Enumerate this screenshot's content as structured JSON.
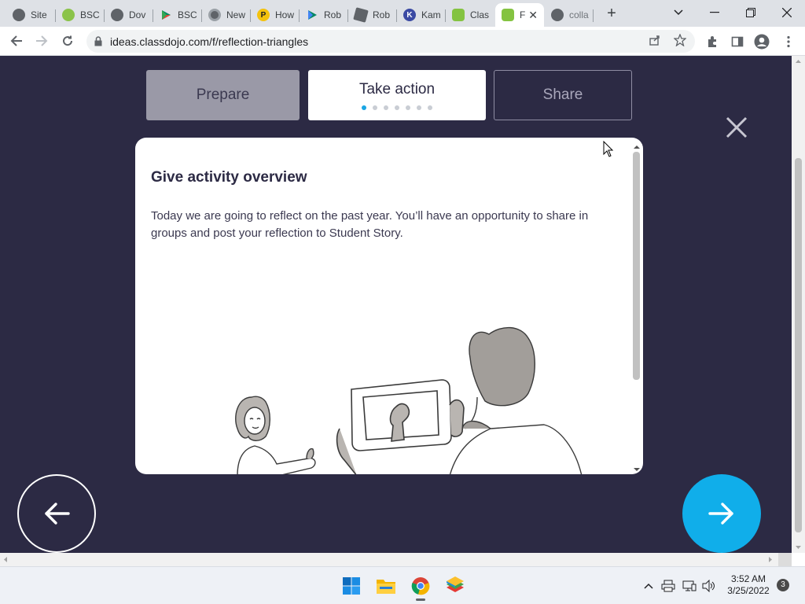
{
  "browser": {
    "tabs": [
      {
        "label": "Site",
        "icon": "globe-icon",
        "color": "#5f6368"
      },
      {
        "label": "BSC",
        "icon": "android-icon",
        "color": "#8bc34a"
      },
      {
        "label": "Dov",
        "icon": "globe-icon",
        "color": "#5f6368"
      },
      {
        "label": "BSC",
        "icon": "play-store-icon",
        "color": "#01875f"
      },
      {
        "label": "New",
        "icon": "chrome-icon",
        "color": "#5f6368"
      },
      {
        "label": "How",
        "icon": "p-icon",
        "color": "#f4c20d"
      },
      {
        "label": "Rob",
        "icon": "play-store-icon",
        "color": "#01875f"
      },
      {
        "label": "Rob",
        "icon": "roblox-icon",
        "color": "#5f6368"
      },
      {
        "label": "Kam",
        "icon": "k-icon",
        "color": "#3b4aa3"
      },
      {
        "label": "Clas",
        "icon": "classdojo-icon",
        "color": "#84c341"
      },
      {
        "label": "F",
        "icon": "classdojo-icon",
        "color": "#84c341",
        "active": true
      },
      {
        "label": "colla",
        "icon": "globe-icon",
        "color": "#5f6368"
      }
    ],
    "url": "ideas.classdojo.com/f/reflection-triangles"
  },
  "page": {
    "steps": {
      "prepare": "Prepare",
      "take_action": "Take action",
      "share": "Share"
    },
    "progress_dots_total": 7,
    "progress_dots_active": 1,
    "card": {
      "title": "Give activity overview",
      "body": "Today we are going to reflect on the past year. You’ll have an opportunity to share in groups and post your reflection to Student Story."
    },
    "colors": {
      "background": "#2c2a44",
      "next_button": "#10aeea",
      "accent_dot": "#1aa6e4"
    }
  },
  "taskbar": {
    "time": "3:52 AM",
    "date": "3/25/2022",
    "notifications": "3"
  }
}
